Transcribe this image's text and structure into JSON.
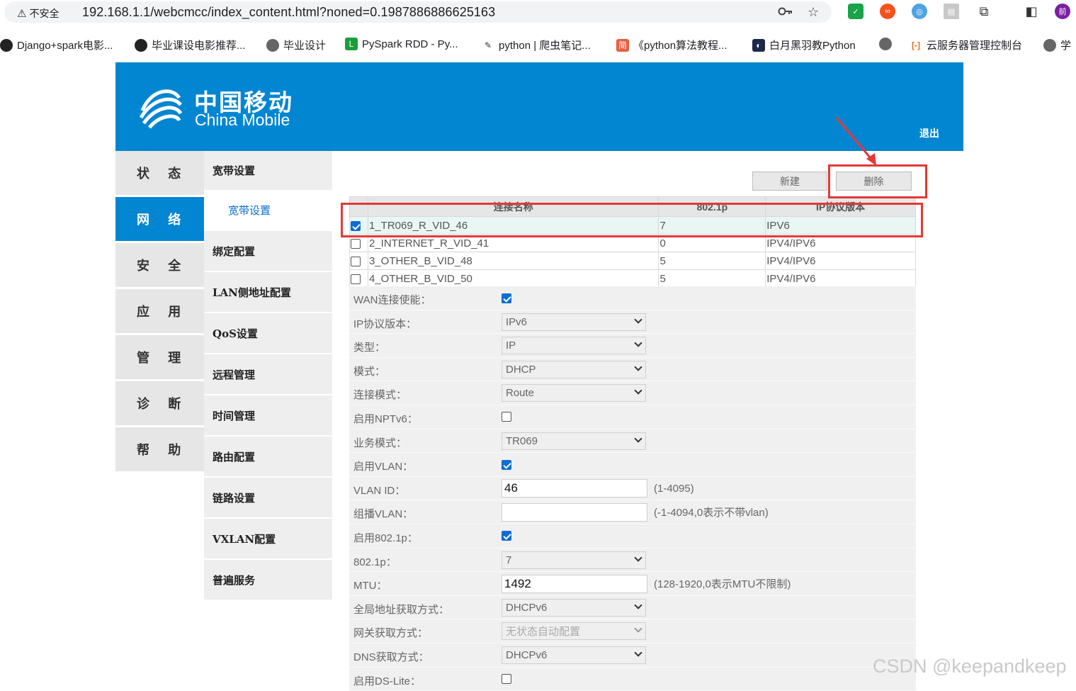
{
  "browser": {
    "security_label": "不安全",
    "url": "192.168.1.1/webcmcc/index_content.html?noned=0.1987886886625163",
    "bookmarks": [
      {
        "label": "Django+spark电影..."
      },
      {
        "label": "毕业课设电影推荐..."
      },
      {
        "label": "毕业设计"
      },
      {
        "label": "PySpark RDD - Py..."
      },
      {
        "label": "python | 爬虫笔记..."
      },
      {
        "label": "《python算法教程..."
      },
      {
        "label": "白月黑羽教Python"
      },
      {
        "label": ""
      },
      {
        "label": "云服务器管理控制台"
      },
      {
        "label": "学"
      }
    ],
    "profile_initial": "前"
  },
  "header": {
    "logo_cn": "中国移动",
    "logo_en": "China Mobile",
    "logout": "退出"
  },
  "main_nav": [
    {
      "label": "状 态",
      "active": false
    },
    {
      "label": "网 络",
      "active": true
    },
    {
      "label": "安 全",
      "active": false
    },
    {
      "label": "应 用",
      "active": false
    },
    {
      "label": "管 理",
      "active": false
    },
    {
      "label": "诊 断",
      "active": false
    },
    {
      "label": "帮 助",
      "active": false
    }
  ],
  "sub_nav": {
    "header": "宽带设置",
    "selected": "宽带设置",
    "items": [
      "绑定配置",
      "LAN侧地址配置",
      "QoS设置",
      "远程管理",
      "时间管理",
      "路由配置",
      "链路设置",
      "VXLAN配置",
      "普遍服务"
    ]
  },
  "actions": {
    "new_label": "新建",
    "delete_label": "删除"
  },
  "table": {
    "columns": [
      "连接名称",
      "802.1p",
      "IP协议版本"
    ],
    "rows": [
      {
        "checked": true,
        "name": "1_TR069_R_VID_46",
        "p8021": "7",
        "ip": "IPV6"
      },
      {
        "checked": false,
        "name": "2_INTERNET_R_VID_41",
        "p8021": "0",
        "ip": "IPV4/IPV6"
      },
      {
        "checked": false,
        "name": "3_OTHER_B_VID_48",
        "p8021": "5",
        "ip": "IPV4/IPV6"
      },
      {
        "checked": false,
        "name": "4_OTHER_B_VID_50",
        "p8021": "5",
        "ip": "IPV4/IPV6"
      }
    ]
  },
  "form": {
    "wan_enable": {
      "label": "WAN连接使能：",
      "checked": true
    },
    "ip_version": {
      "label": "IP协议版本：",
      "value": "IPv6"
    },
    "type": {
      "label": "类型：",
      "value": "IP"
    },
    "mode": {
      "label": "模式：",
      "value": "DHCP"
    },
    "conn_mode": {
      "label": "连接模式：",
      "value": "Route"
    },
    "nptv6": {
      "label": "启用NPTv6：",
      "checked": false
    },
    "service_mode": {
      "label": "业务模式：",
      "value": "TR069"
    },
    "vlan_enable": {
      "label": "启用VLAN：",
      "checked": true
    },
    "vlan_id": {
      "label": "VLAN ID：",
      "value": "46",
      "hint": "(1-4095)"
    },
    "mcast_vlan": {
      "label": "组播VLAN：",
      "value": "",
      "hint": "(-1-4094,0表示不带vlan)"
    },
    "p8021_enable": {
      "label": "启用802.1p：",
      "checked": true
    },
    "p8021": {
      "label": "802.1p：",
      "value": "7"
    },
    "mtu": {
      "label": "MTU：",
      "value": "1492",
      "hint": "(128-1920,0表示MTU不限制)"
    },
    "global_addr": {
      "label": "全局地址获取方式：",
      "value": "DHCPv6"
    },
    "gateway": {
      "label": "网关获取方式：",
      "value": "无状态自动配置"
    },
    "dns": {
      "label": "DNS获取方式：",
      "value": "DHCPv6"
    },
    "dslite": {
      "label": "启用DS-Lite：",
      "checked": false
    }
  },
  "watermark": "CSDN @keepandkeep"
}
